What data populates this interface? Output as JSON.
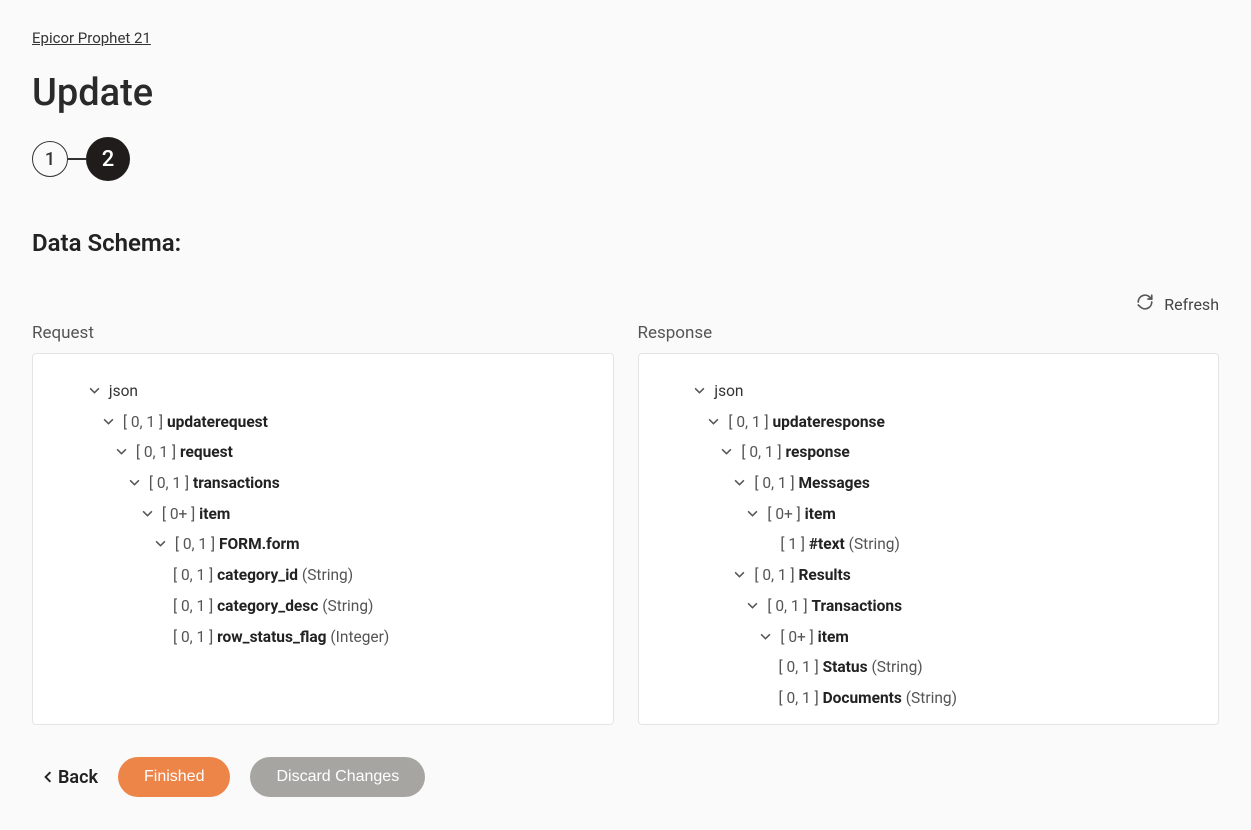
{
  "breadcrumb": "Epicor Prophet 21",
  "title": "Update",
  "stepper": {
    "step1": "1",
    "step2": "2"
  },
  "section_heading": "Data Schema:",
  "refresh_label": "Refresh",
  "request": {
    "title": "Request",
    "root": "json",
    "n1_card": "[ 0, 1 ]",
    "n1_name": "updaterequest",
    "n2_card": "[ 0, 1 ]",
    "n2_name": "request",
    "n3_card": "[ 0, 1 ]",
    "n3_name": "transactions",
    "n4_card": "[ 0+ ]",
    "n4_name": "item",
    "n5_card": "[ 0, 1 ]",
    "n5_name": "FORM.form",
    "n6a_card": "[ 0, 1 ]",
    "n6a_name": "category_id",
    "n6a_type": "(String)",
    "n6b_card": "[ 0, 1 ]",
    "n6b_name": "category_desc",
    "n6b_type": "(String)",
    "n6c_card": "[ 0, 1 ]",
    "n6c_name": "row_status_flag",
    "n6c_type": "(Integer)"
  },
  "response": {
    "title": "Response",
    "root": "json",
    "n1_card": "[ 0, 1 ]",
    "n1_name": "updateresponse",
    "n2_card": "[ 0, 1 ]",
    "n2_name": "response",
    "n3_card": "[ 0, 1 ]",
    "n3_name": "Messages",
    "n4_card": "[ 0+ ]",
    "n4_name": "item",
    "n5_card": "[ 1 ]",
    "n5_name": "#text",
    "n5_type": "(String)",
    "n6_card": "[ 0, 1 ]",
    "n6_name": "Results",
    "n7_card": "[ 0, 1 ]",
    "n7_name": "Transactions",
    "n8_card": "[ 0+ ]",
    "n8_name": "item",
    "n9a_card": "[ 0, 1 ]",
    "n9a_name": "Status",
    "n9a_type": "(String)",
    "n9b_card": "[ 0, 1 ]",
    "n9b_name": "Documents",
    "n9b_type": "(String)"
  },
  "footer": {
    "back": "Back",
    "finished": "Finished",
    "discard": "Discard Changes"
  }
}
